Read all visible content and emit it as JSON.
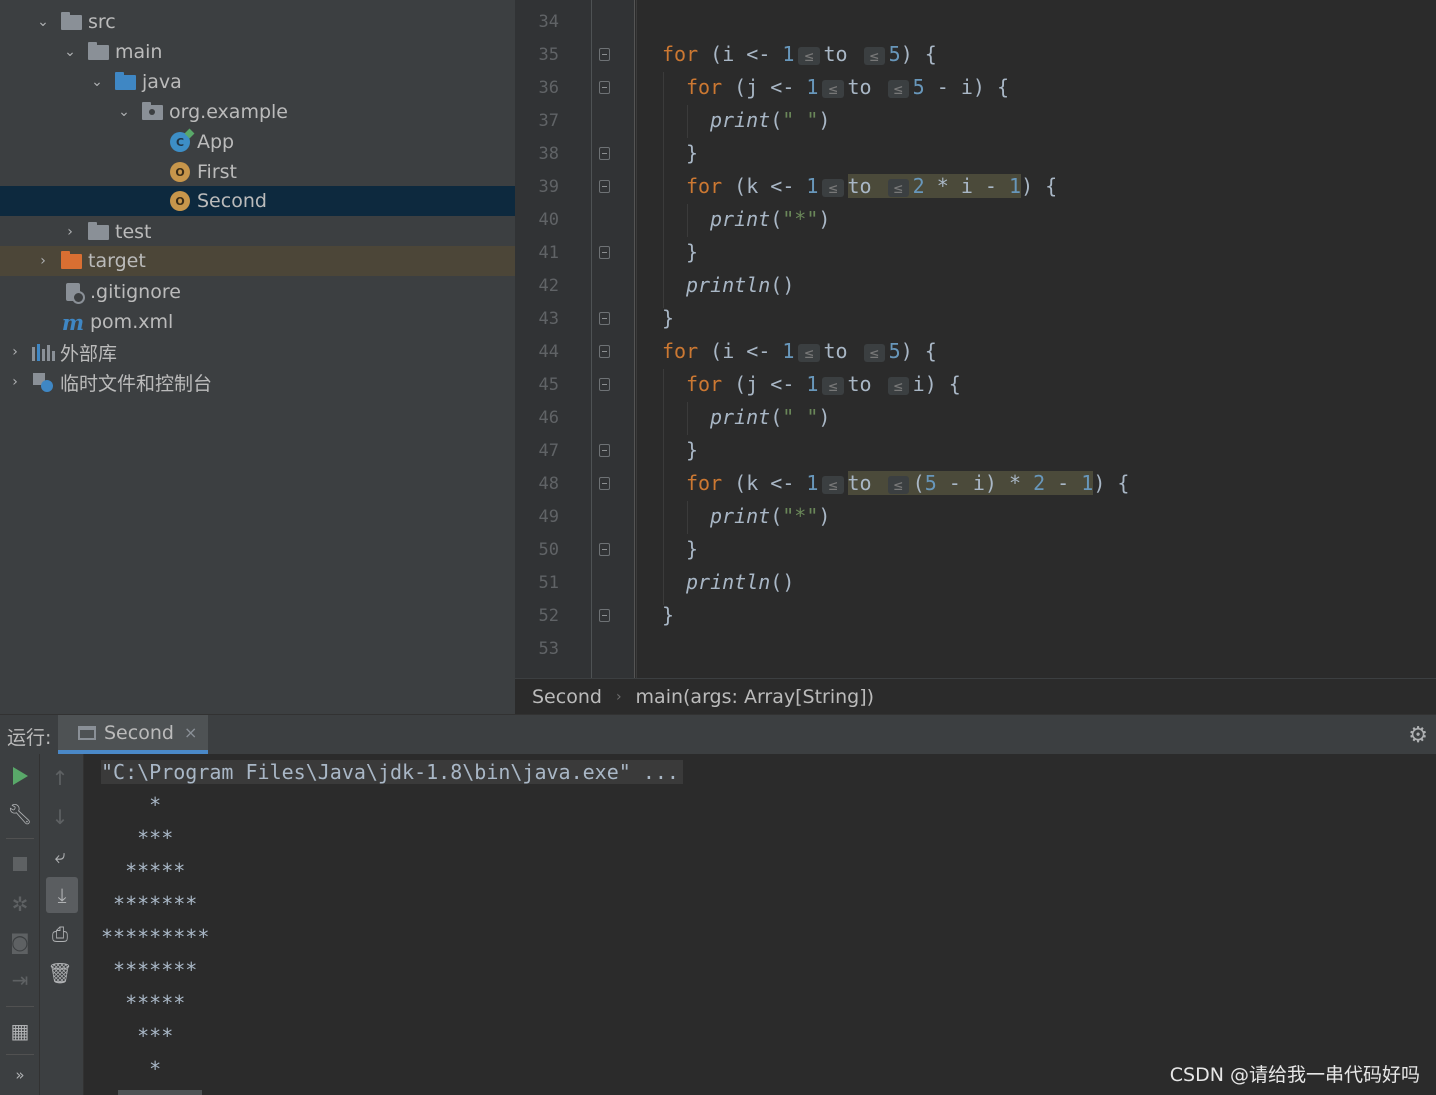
{
  "project_tree": [
    {
      "label": "src",
      "icon": "folder-icon",
      "kind": "folder",
      "expanded": true,
      "level": 1
    },
    {
      "label": "main",
      "icon": "folder-icon",
      "kind": "folder",
      "expanded": true,
      "level": 2
    },
    {
      "label": "java",
      "icon": "source-folder-icon",
      "kind": "source",
      "expanded": true,
      "level": 3
    },
    {
      "label": "org.example",
      "icon": "package-icon",
      "kind": "package",
      "expanded": true,
      "level": 4
    },
    {
      "label": "App",
      "icon": "scala-class-icon",
      "kind": "class",
      "level": 5
    },
    {
      "label": "First",
      "icon": "scala-object-icon",
      "kind": "object",
      "level": 5
    },
    {
      "label": "Second",
      "icon": "scala-object-icon",
      "kind": "object",
      "level": 5,
      "selected": true
    },
    {
      "label": "test",
      "icon": "folder-icon",
      "kind": "folder",
      "expanded": false,
      "level": 2
    },
    {
      "label": "target",
      "icon": "excluded-folder-icon",
      "kind": "excluded",
      "expanded": false,
      "level": 1,
      "highlighted": true
    },
    {
      "label": ".gitignore",
      "icon": "gitignore-file-icon",
      "kind": "git",
      "level": 1
    },
    {
      "label": "pom.xml",
      "icon": "maven-file-icon",
      "kind": "maven",
      "level": 1
    },
    {
      "label": "外部库",
      "icon": "external-libraries-icon",
      "kind": "libs",
      "expanded": false,
      "level": 0
    },
    {
      "label": "临时文件和控制台",
      "icon": "scratches-icon",
      "kind": "scratch",
      "expanded": false,
      "level": 0
    }
  ],
  "editor": {
    "line_numbers": [
      "34",
      "35",
      "36",
      "37",
      "38",
      "39",
      "40",
      "41",
      "42",
      "43",
      "44",
      "45",
      "46",
      "47",
      "48",
      "49",
      "50",
      "51",
      "52",
      "53"
    ],
    "inlay_hint": "≤",
    "lines": {
      "l35": {
        "kw": "for",
        "a": " (i <- ",
        "n1": "1",
        "to": "to",
        "n2": "5",
        "b": ") {"
      },
      "l36": {
        "kw": "for",
        "a": " (j <- ",
        "n1": "1",
        "to": "to",
        "n2": "5",
        "b": " - i) {"
      },
      "l37": {
        "fn": "print",
        "a": "(",
        "s": "\" \"",
        "b": ")"
      },
      "l38": {
        "a": "}"
      },
      "l39": {
        "kw": "for",
        "a": " (k <- ",
        "n1": "1",
        "to": "to",
        "n2": "2",
        "m": " * i - ",
        "n3": "1",
        "b": ") {"
      },
      "l40": {
        "fn": "print",
        "a": "(",
        "s": "\"*\"",
        "b": ")"
      },
      "l41": {
        "a": "}"
      },
      "l42": {
        "fn": "println",
        "a": "()"
      },
      "l43": {
        "a": "}"
      },
      "l44": {
        "kw": "for",
        "a": " (i <- ",
        "n1": "1",
        "to": "to",
        "n2": "5",
        "b": ") {"
      },
      "l45": {
        "kw": "for",
        "a": " (j <- ",
        "n1": "1",
        "to": "to",
        "m": "i",
        "b": ") {"
      },
      "l46": {
        "fn": "print",
        "a": "(",
        "s": "\" \"",
        "b": ")"
      },
      "l47": {
        "a": "}"
      },
      "l48": {
        "kw": "for",
        "a": " (k <- ",
        "n1": "1",
        "to": "to",
        "p": "(",
        "n2": "5",
        "m": " - i) * ",
        "n3": "2",
        "q": " - ",
        "n4": "1",
        "b": ") {"
      },
      "l49": {
        "fn": "print",
        "a": "(",
        "s": "\"*\"",
        "b": ")"
      },
      "l50": {
        "a": "}"
      },
      "l51": {
        "fn": "println",
        "a": "()"
      },
      "l52": {
        "a": "}"
      }
    }
  },
  "breadcrumb": {
    "items": [
      "Second",
      "main(args: Array[String])"
    ],
    "separator": "›"
  },
  "run_panel": {
    "label": "运行:",
    "tab_label": "Second",
    "close_icon": "×",
    "settings_icon": "gear-icon",
    "command": "\"C:\\Program Files\\Java\\jdk-1.8\\bin\\java.exe\" ...",
    "output": [
      "    *",
      "   ***",
      "  *****",
      " *******",
      "*********",
      " *******",
      "  *****",
      "   ***",
      "    *"
    ]
  },
  "left_toolbar": [
    "rerun-icon",
    "wrench-icon",
    "stop-icon",
    "debug-icon",
    "camera-icon",
    "login-icon",
    "layout-icon",
    "more-icon"
  ],
  "second_toolbar": [
    "up-arrow-icon",
    "down-arrow-icon",
    "soft-wrap-icon",
    "scroll-to-end-icon",
    "print-icon",
    "trash-icon"
  ],
  "more_label": "»",
  "watermark": "CSDN @请给我一串代码好吗",
  "colors": {
    "keyword": "#cc7832",
    "number": "#6897bb",
    "string": "#6a8759",
    "text": "#a9b7c6",
    "selection": "#0d293e",
    "tab_underline": "#4a88c7",
    "run_green": "#59a869"
  }
}
